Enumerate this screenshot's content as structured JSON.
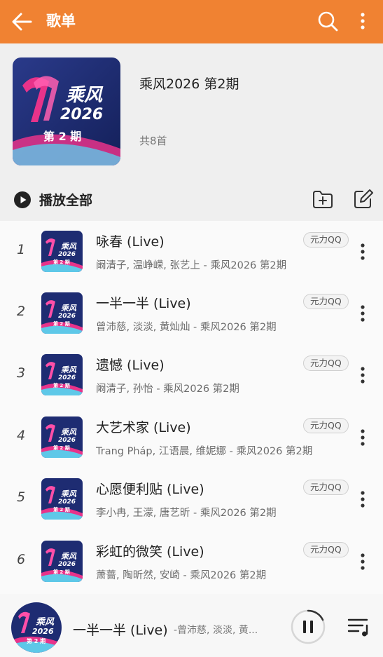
{
  "topbar": {
    "title": "歌单"
  },
  "playlist": {
    "cover_brand_line1": "乘风",
    "cover_brand_line2": "2026",
    "cover_episode": "第 2 期",
    "title": "乘风2026 第2期",
    "count_label": "共8首"
  },
  "actions": {
    "play_all_label": "播放全部"
  },
  "songs": [
    {
      "index": "1",
      "title": "咏春 (Live)",
      "subtitle": "阚清子, 温峥嵘, 张艺上 - 乘风2026 第2期",
      "badge": "元力QQ"
    },
    {
      "index": "2",
      "title": "一半一半 (Live)",
      "subtitle": "曾沛慈, 淡淡, 黄灿灿 - 乘风2026 第2期",
      "badge": "元力QQ"
    },
    {
      "index": "3",
      "title": "遗憾 (Live)",
      "subtitle": "阚清子, 孙怡 - 乘风2026 第2期",
      "badge": "元力QQ"
    },
    {
      "index": "4",
      "title": "大艺术家 (Live)",
      "subtitle": "Trang Pháp, 江语晨, 维妮娜 - 乘风2026 第2期",
      "badge": "元力QQ"
    },
    {
      "index": "5",
      "title": "心愿便利贴 (Live)",
      "subtitle": "李小冉, 王濛, 唐艺昕 - 乘风2026 第2期",
      "badge": "元力QQ"
    },
    {
      "index": "6",
      "title": "彩虹的微笑 (Live)",
      "subtitle": "萧蔷, 陶昕然, 安崎 - 乘风2026 第2期",
      "badge": "元力QQ"
    }
  ],
  "now_playing": {
    "title": "一半一半 (Live)",
    "artist": "-曾沛慈, 淡淡, 黄..."
  },
  "colors": {
    "accent": "#f08232",
    "cover_bg": "#1c2a6e",
    "cover_pink": "#e8338a"
  }
}
